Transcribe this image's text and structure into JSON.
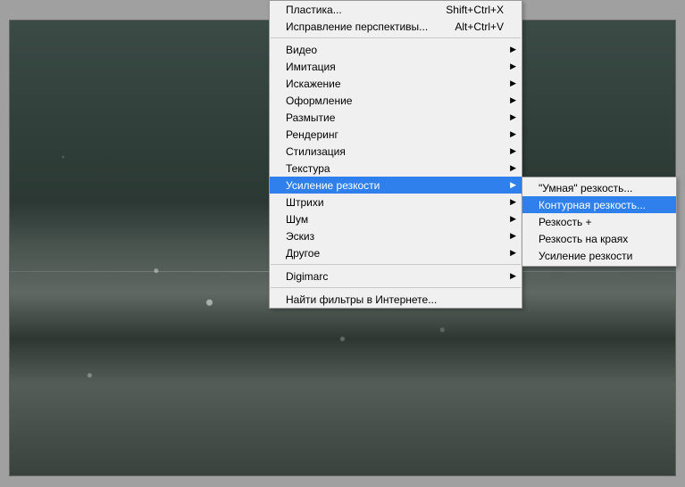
{
  "menu": {
    "top": [
      {
        "label": "Пластика...",
        "shortcut": "Shift+Ctrl+X"
      },
      {
        "label": "Исправление перспективы...",
        "shortcut": "Alt+Ctrl+V"
      }
    ],
    "filters": [
      {
        "label": "Видео",
        "sub": true
      },
      {
        "label": "Имитация",
        "sub": true
      },
      {
        "label": "Искажение",
        "sub": true
      },
      {
        "label": "Оформление",
        "sub": true
      },
      {
        "label": "Размытие",
        "sub": true
      },
      {
        "label": "Рендеринг",
        "sub": true
      },
      {
        "label": "Стилизация",
        "sub": true
      },
      {
        "label": "Текстура",
        "sub": true
      },
      {
        "label": "Усиление резкости",
        "sub": true,
        "hl": true
      },
      {
        "label": "Штрихи",
        "sub": true
      },
      {
        "label": "Шум",
        "sub": true
      },
      {
        "label": "Эскиз",
        "sub": true
      },
      {
        "label": "Другое",
        "sub": true
      }
    ],
    "digimarc": {
      "label": "Digimarc",
      "sub": true
    },
    "browse": {
      "label": "Найти фильтры в Интернете..."
    },
    "submenu": [
      {
        "label": "\"Умная\" резкость..."
      },
      {
        "label": "Контурная резкость...",
        "hl": true
      },
      {
        "label": "Резкость +"
      },
      {
        "label": "Резкость на краях"
      },
      {
        "label": "Усиление резкости"
      }
    ]
  }
}
